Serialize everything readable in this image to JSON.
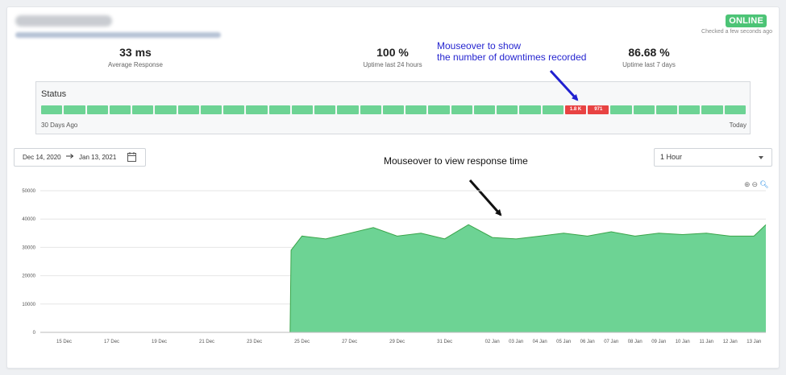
{
  "status": {
    "online_label": "ONLINE",
    "checked_text": "Checked a few seconds ago"
  },
  "stats": [
    {
      "value": "33 ms",
      "label": "Average Response"
    },
    {
      "value": "100 %",
      "label": "Uptime last 24 hours"
    },
    {
      "value": "86.68 %",
      "label": "Uptime last 7 days"
    }
  ],
  "annotations": {
    "mouseover_downtime_line1": "Mouseover to show",
    "mouseover_downtime_line2": "the number of downtimes recorded",
    "mouseover_response": "Mouseover to view response time"
  },
  "status_bar": {
    "title": "Status",
    "left_label": "30 Days Ago",
    "right_label": "Today",
    "segments": [
      {
        "state": "up",
        "label": ""
      },
      {
        "state": "up",
        "label": ""
      },
      {
        "state": "up",
        "label": ""
      },
      {
        "state": "up",
        "label": ""
      },
      {
        "state": "up",
        "label": ""
      },
      {
        "state": "up",
        "label": ""
      },
      {
        "state": "up",
        "label": ""
      },
      {
        "state": "up",
        "label": ""
      },
      {
        "state": "up",
        "label": ""
      },
      {
        "state": "up",
        "label": ""
      },
      {
        "state": "up",
        "label": ""
      },
      {
        "state": "up",
        "label": ""
      },
      {
        "state": "up",
        "label": ""
      },
      {
        "state": "up",
        "label": ""
      },
      {
        "state": "up",
        "label": ""
      },
      {
        "state": "up",
        "label": ""
      },
      {
        "state": "up",
        "label": ""
      },
      {
        "state": "up",
        "label": ""
      },
      {
        "state": "up",
        "label": ""
      },
      {
        "state": "up",
        "label": ""
      },
      {
        "state": "up",
        "label": ""
      },
      {
        "state": "up",
        "label": ""
      },
      {
        "state": "up",
        "label": ""
      },
      {
        "state": "down",
        "label": "1.8 K"
      },
      {
        "state": "down",
        "label": "971"
      },
      {
        "state": "up",
        "label": ""
      },
      {
        "state": "up",
        "label": ""
      },
      {
        "state": "up",
        "label": ""
      },
      {
        "state": "up",
        "label": ""
      },
      {
        "state": "up",
        "label": ""
      },
      {
        "state": "up",
        "label": ""
      }
    ],
    "colors": {
      "up": "#6dd394",
      "down": "#e84343"
    }
  },
  "filters": {
    "date_start": "Dec 14, 2020",
    "date_end": "Jan 13, 2021",
    "arrow_icon": "arrow-right-icon",
    "calendar_icon": "calendar-icon",
    "interval_value": "1 Hour"
  },
  "chart_data": {
    "type": "area",
    "title": "",
    "xlabel": "",
    "ylabel": "",
    "ylim": [
      0,
      50000
    ],
    "yticks": [
      0,
      10000,
      20000,
      30000,
      40000,
      50000
    ],
    "grid": true,
    "color": "#6dd394",
    "line_color": "#3aa54a",
    "xlim": [
      "2020-12-14",
      "2021-01-13"
    ],
    "xtick_labels": [
      "15 Dec",
      "17 Dec",
      "19 Dec",
      "21 Dec",
      "23 Dec",
      "25 Dec",
      "27 Dec",
      "29 Dec",
      "31 Dec",
      "02 Jan",
      "03 Jan",
      "04 Jan",
      "05 Jan",
      "06 Jan",
      "07 Jan",
      "08 Jan",
      "09 Jan",
      "10 Jan",
      "11 Jan",
      "12 Jan",
      "13 Jan"
    ],
    "series": [
      {
        "points": [
          [
            "2020-12-14",
            0
          ],
          [
            "2020-12-24 12:00",
            0
          ],
          [
            "2020-12-24 13:00",
            29000
          ],
          [
            "2020-12-25",
            34000
          ],
          [
            "2020-12-26",
            33000
          ],
          [
            "2020-12-27",
            35000
          ],
          [
            "2020-12-28",
            37000
          ],
          [
            "2020-12-29",
            34000
          ],
          [
            "2020-12-30",
            35000
          ],
          [
            "2020-12-31",
            33000
          ],
          [
            "2021-01-01",
            38000
          ],
          [
            "2021-01-02",
            33500
          ],
          [
            "2021-01-03",
            33000
          ],
          [
            "2021-01-04",
            34000
          ],
          [
            "2021-01-05",
            35000
          ],
          [
            "2021-01-06",
            34000
          ],
          [
            "2021-01-07",
            35500
          ],
          [
            "2021-01-08",
            34000
          ],
          [
            "2021-01-09",
            35000
          ],
          [
            "2021-01-10",
            34500
          ],
          [
            "2021-01-11",
            35000
          ],
          [
            "2021-01-12",
            34000
          ],
          [
            "2021-01-13",
            34000
          ],
          [
            "2021-01-13 12:00",
            38000
          ]
        ]
      }
    ],
    "tools": {
      "zoom_in_icon": "zoom-in-icon",
      "zoom_out_icon": "zoom-out-icon",
      "search_icon": "magnifier-icon"
    }
  }
}
